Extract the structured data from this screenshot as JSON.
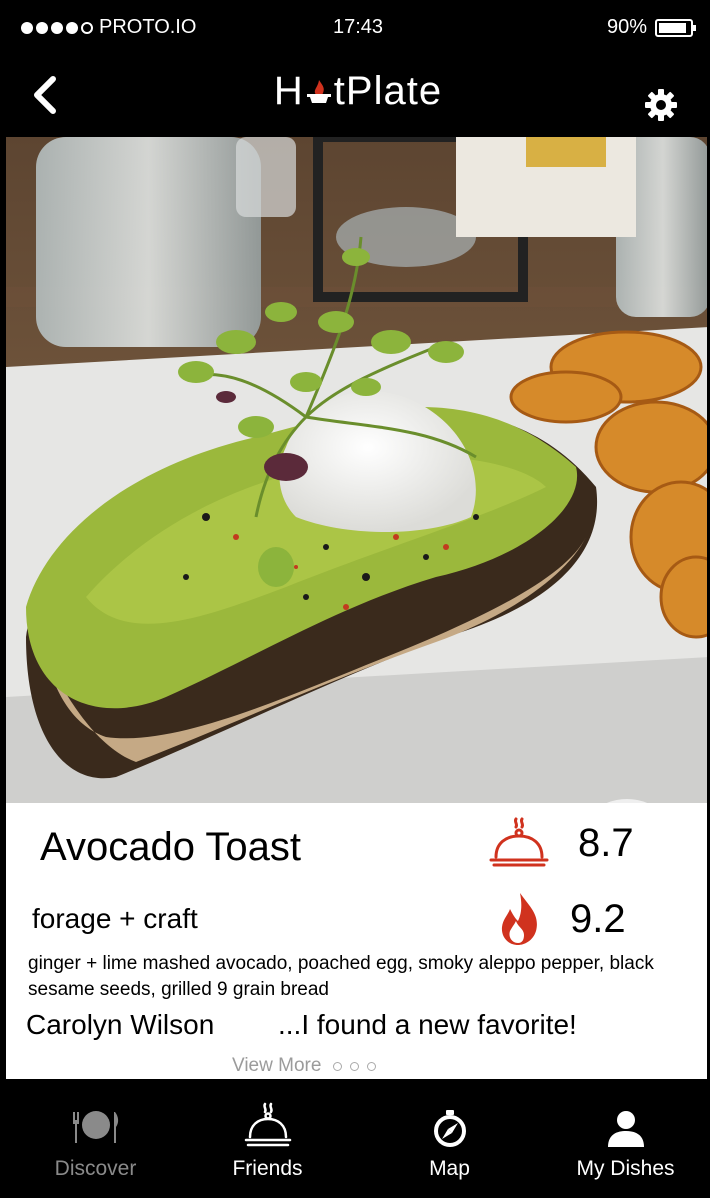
{
  "status_bar": {
    "carrier": "PROTO.IO",
    "time": "17:43",
    "battery": "90%",
    "battery_level": 0.9,
    "signal_bars": 4
  },
  "nav": {
    "back_icon": "chevron-left-icon",
    "logo_prefix": "H",
    "logo_suffix": "tPlate",
    "settings_icon": "gear-icon"
  },
  "dish": {
    "name": "Avocado Toast",
    "restaurant": "forage + craft",
    "description": "ginger + lime mashed avocado, poached egg, smoky aleppo pepper, black sesame seeds, grilled 9 grain bread",
    "friends_score": "8.7",
    "hot_score": "9.2"
  },
  "review": {
    "reviewer": "Carolyn Wilson",
    "text": "...I found a new favorite!",
    "view_more": "View More"
  },
  "tabs": [
    {
      "label": "Discover",
      "icon": "plate-cutlery-icon",
      "active": false
    },
    {
      "label": "Friends",
      "icon": "cloche-icon",
      "active": true
    },
    {
      "label": "Map",
      "icon": "compass-icon",
      "active": true
    },
    {
      "label": "My Dishes",
      "icon": "user-icon",
      "active": true
    }
  ],
  "colors": {
    "accent_red": "#d0321e",
    "background": "#000000",
    "panel": "#ffffff"
  }
}
